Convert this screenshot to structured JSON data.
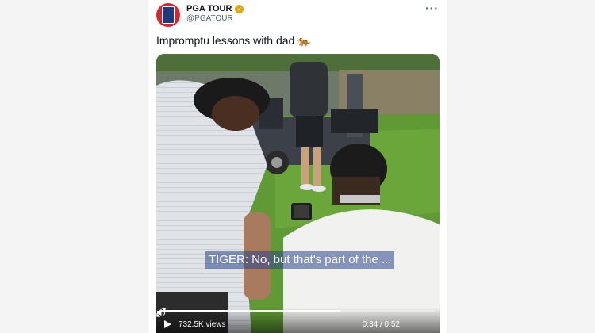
{
  "account": {
    "display_name": "PGA TOUR",
    "handle": "@PGATOUR",
    "verified_icon": "verified-badge-icon",
    "logo_text": "PGA TOUR"
  },
  "tweet": {
    "text": "Impromptu lessons with dad",
    "emoji": "🐅"
  },
  "video": {
    "caption": "TIGER: No, but that's part of the ...",
    "views": "732.5K views",
    "time": "0:34 / 0:52",
    "progress": 0.654
  },
  "colors": {
    "brand_red": "#d8262f",
    "brand_blue": "#1d3a7a",
    "verified_gold": "#e8a60e",
    "grass": "#5d8a35"
  }
}
